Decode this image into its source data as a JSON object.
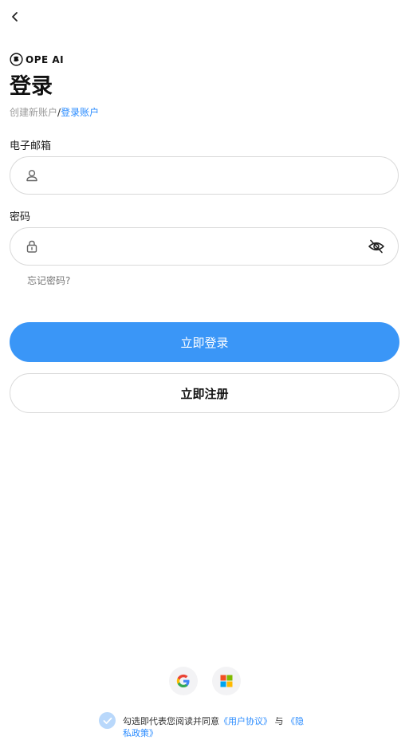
{
  "header": {
    "brand": "OPE AI",
    "title": "登录"
  },
  "subtitle": {
    "create": "创建新账户",
    "separator": "/",
    "login": "登录账户"
  },
  "email": {
    "label": "电子邮箱",
    "value": "",
    "placeholder": ""
  },
  "password": {
    "label": "密码",
    "value": "",
    "placeholder": ""
  },
  "forgot_label": "忘记密码?",
  "buttons": {
    "login": "立即登录",
    "register": "立即注册"
  },
  "social": {
    "google": "google-icon",
    "microsoft": "microsoft-icon"
  },
  "agreement": {
    "prefix": "勾选即代表您阅读并同意",
    "user_agreement": "《用户协议》",
    "and": "与",
    "privacy_policy": "《隐私政策》"
  },
  "colors": {
    "accent": "#3a96f7",
    "link": "#2b8cff",
    "check": "#b9d8fb"
  }
}
